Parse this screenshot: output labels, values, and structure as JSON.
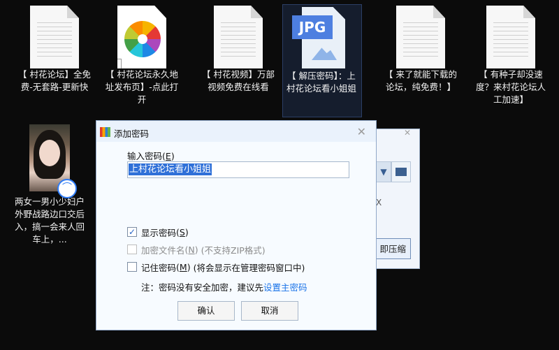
{
  "desktop": {
    "icons": [
      {
        "type": "doc",
        "label": "【 村花论坛】全免费-无套路-更新快"
      },
      {
        "type": "shortcut",
        "label": "【 村花论坛永久地址发布页】-点此打开"
      },
      {
        "type": "doc",
        "label": "【 村花视频】万部视频免费在线看"
      },
      {
        "type": "jpg",
        "badge": "JPG",
        "label": "【 解压密码】：上村花论坛看小姐姐"
      },
      {
        "type": "doc",
        "label": "【 来了就能下载的论坛，纯免费！】"
      },
      {
        "type": "doc",
        "label": "【 有种子却没速度？来村花论坛人工加速】"
      },
      {
        "type": "photo",
        "label": "两女一男小少妇户外野战路边口交后入，搞一会来人回车上，..."
      }
    ]
  },
  "background_window": {
    "text_x": "X",
    "button_label": "即压缩"
  },
  "dialog": {
    "title": "添加密码",
    "close_glyph": "✕",
    "password_label": "输入密码",
    "password_shortcut": "E",
    "password_value": "上村花论坛看小姐姐",
    "show_password": {
      "label": "显示密码",
      "shortcut": "S",
      "checked": true
    },
    "encrypt_names": {
      "label": "加密文件名",
      "shortcut": "N",
      "note": "(不支持ZIP格式)",
      "checked": false,
      "disabled": true
    },
    "remember_password": {
      "label": "记住密码",
      "shortcut": "M",
      "note": "(将会显示在管理密码窗口中)",
      "checked": false
    },
    "note_text": "注：密码没有安全加密，建议先",
    "note_link": "设置主密码",
    "ok_label": "确认",
    "cancel_label": "取消"
  },
  "colors": {
    "accent": "#2f70d8",
    "link": "#1a73e8",
    "desktop_bg": "#0b0b0b"
  }
}
